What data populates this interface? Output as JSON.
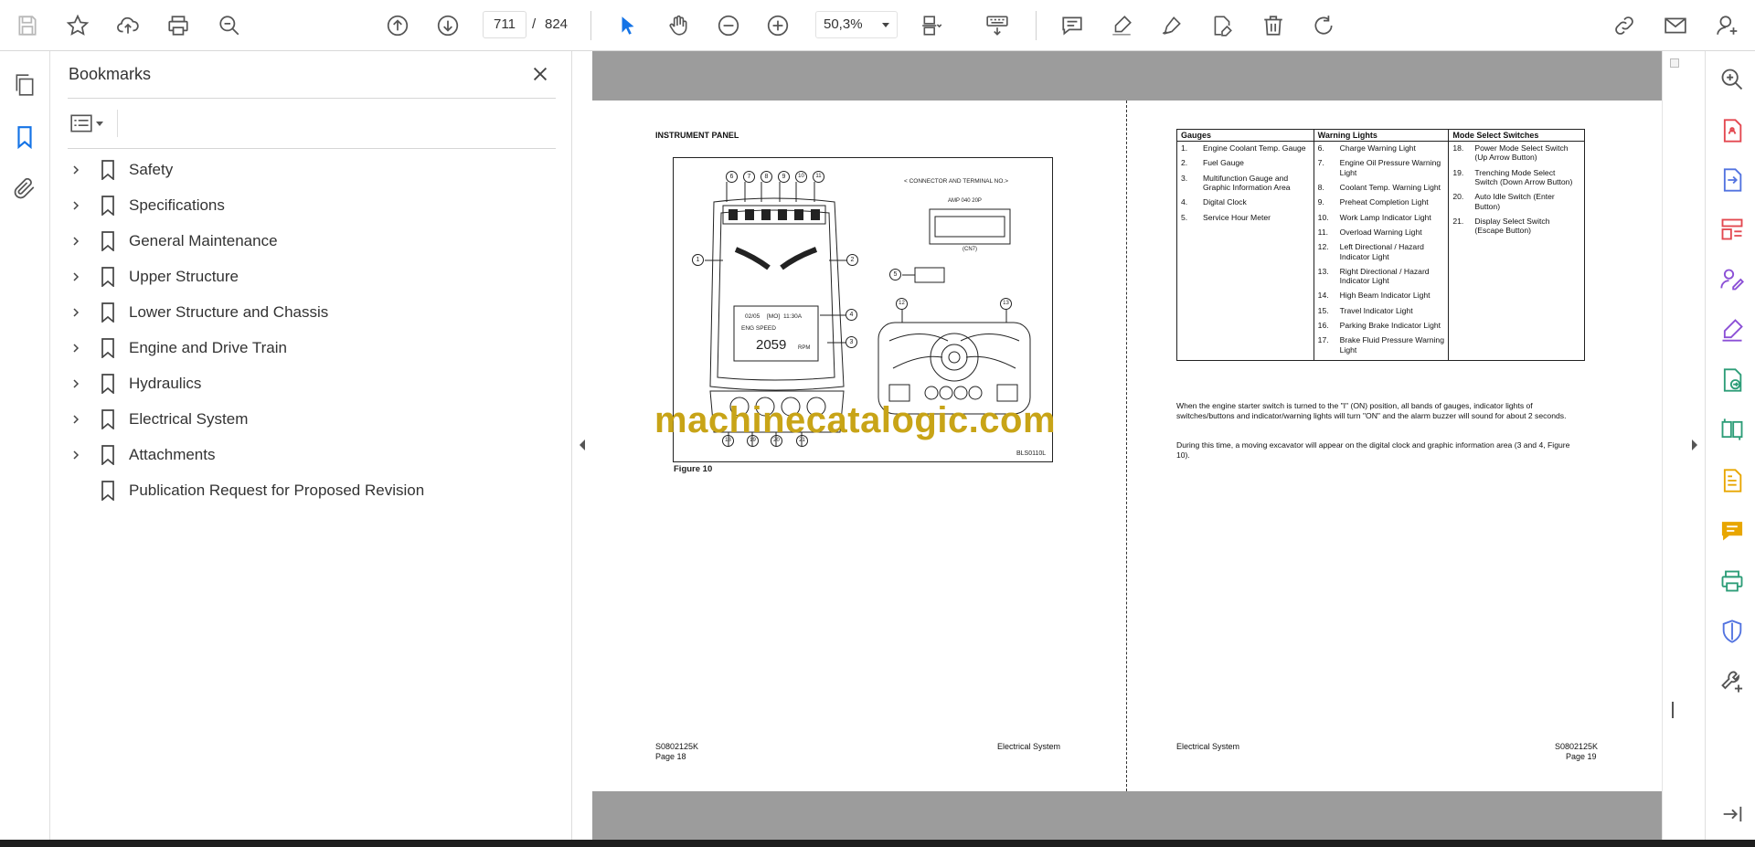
{
  "toolbar": {
    "current_page": "711",
    "page_separator": "/",
    "total_pages": "824",
    "zoom": "50,3%"
  },
  "bookmarks_panel": {
    "title": "Bookmarks",
    "items": [
      {
        "label": "Safety",
        "expandable": true
      },
      {
        "label": "Specifications",
        "expandable": true
      },
      {
        "label": "General Maintenance",
        "expandable": true
      },
      {
        "label": "Upper Structure",
        "expandable": true
      },
      {
        "label": "Lower Structure and Chassis",
        "expandable": true
      },
      {
        "label": "Engine and Drive Train",
        "expandable": true
      },
      {
        "label": "Hydraulics",
        "expandable": true
      },
      {
        "label": "Electrical System",
        "expandable": true
      },
      {
        "label": "Attachments",
        "expandable": true
      },
      {
        "label": "Publication Request for Proposed Revision",
        "expandable": false
      }
    ]
  },
  "page_left": {
    "heading": "INSTRUMENT PANEL",
    "connector_label": "< CONNECTOR AND TERMINAL NO.>",
    "connector_part": "AMP 040 20P",
    "connector_note": "(CN7)",
    "display_date": "02/05",
    "display_day": "[MO]",
    "display_time": "11:30A",
    "display_eng_label": "ENG SPEED",
    "display_rpm_value": "2059",
    "display_rpm_unit": "RPM",
    "callouts": [
      "6",
      "7",
      "8",
      "9",
      "10",
      "11",
      "1",
      "2",
      "4",
      "3",
      "5",
      "12",
      "13",
      "18",
      "19",
      "20",
      "21"
    ],
    "figure_caption": "Figure 10",
    "figure_code": "BLS0110L",
    "watermark": "machinecatalogic.com",
    "footer_doc": "S0802125K",
    "footer_page": "Page 18",
    "footer_section": "Electrical System"
  },
  "page_right": {
    "table": {
      "headers": [
        "Gauges",
        "Warning Lights",
        "Mode Select Switches"
      ],
      "gauges": [
        {
          "n": "1.",
          "t": "Engine Coolant Temp. Gauge"
        },
        {
          "n": "2.",
          "t": "Fuel Gauge"
        },
        {
          "n": "3.",
          "t": "Multifunction Gauge and Graphic Information Area"
        },
        {
          "n": "4.",
          "t": "Digital Clock"
        },
        {
          "n": "5.",
          "t": "Service Hour Meter"
        }
      ],
      "warning_lights": [
        {
          "n": "6.",
          "t": "Charge Warning Light"
        },
        {
          "n": "7.",
          "t": "Engine Oil Pressure Warning Light"
        },
        {
          "n": "8.",
          "t": "Coolant Temp. Warning Light"
        },
        {
          "n": "9.",
          "t": "Preheat Completion Light"
        },
        {
          "n": "10.",
          "t": "Work Lamp Indicator Light"
        },
        {
          "n": "11.",
          "t": "Overload Warning Light"
        },
        {
          "n": "12.",
          "t": "Left Directional / Hazard Indicator Light"
        },
        {
          "n": "13.",
          "t": "Right Directional / Hazard Indicator Light"
        },
        {
          "n": "14.",
          "t": "High Beam Indicator Light"
        },
        {
          "n": "15.",
          "t": "Travel Indicator Light"
        },
        {
          "n": "16.",
          "t": "Parking Brake Indicator Light"
        },
        {
          "n": "17.",
          "t": "Brake Fluid Pressure Warning Light"
        }
      ],
      "mode_switches": [
        {
          "n": "18.",
          "t": "Power Mode Select Switch (Up Arrow Button)"
        },
        {
          "n": "19.",
          "t": "Trenching Mode Select Switch (Down Arrow Button)"
        },
        {
          "n": "20.",
          "t": "Auto Idle Switch (Enter Button)"
        },
        {
          "n": "21.",
          "t": "Display Select Switch (Escape Button)"
        }
      ]
    },
    "paragraph1": "When the engine starter switch is turned to the \"I\" (ON) position, all bands of gauges, indicator lights of switches/buttons and indicator/warning lights will turn \"ON\" and the alarm buzzer will sound for about 2 seconds.",
    "paragraph2": "During this time, a moving excavator will appear on the digital clock and graphic information area (3 and 4, Figure 10).",
    "footer_section": "Electrical System",
    "footer_doc": "S0802125K",
    "footer_page": "Page 19"
  },
  "colors": {
    "accent_blue": "#1473e6",
    "viewer_gray": "#9c9c9c",
    "watermark_gold": "#c8a417",
    "tool_purple": "#8b4fd6",
    "tool_red": "#e34850",
    "tool_green": "#2d9d78",
    "tool_yellow": "#e8a600"
  }
}
